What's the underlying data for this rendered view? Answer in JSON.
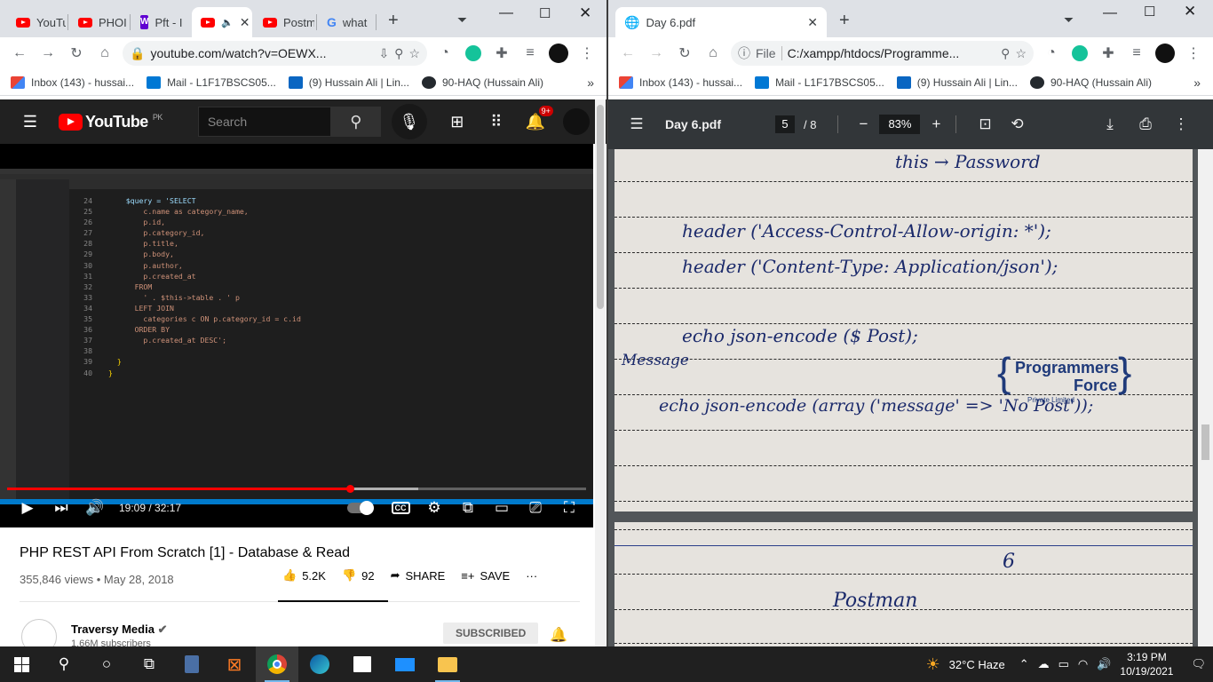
{
  "left": {
    "tabs": [
      {
        "label": "YouTu",
        "icon": "youtube-icon"
      },
      {
        "label": "PHOI",
        "icon": "youtube-icon"
      },
      {
        "label": "Pft - I",
        "icon": "w-icon"
      },
      {
        "label": "",
        "icon": "youtube-icon",
        "active": true
      },
      {
        "label": "Postm",
        "icon": "youtube-icon"
      },
      {
        "label": "what",
        "icon": "google-icon"
      }
    ],
    "url": "youtube.com/watch?v=OEWX...",
    "bookmarks": [
      {
        "label": "Inbox (143) - hussai...",
        "icon": "gmail-icon"
      },
      {
        "label": "Mail - L1F17BSCS05...",
        "icon": "outlook-icon"
      },
      {
        "label": "(9) Hussain Ali | Lin...",
        "icon": "linkedin-icon"
      },
      {
        "label": "90-HAQ (Hussain Ali)",
        "icon": "github-icon"
      }
    ],
    "youtube": {
      "logo": "YouTube",
      "country": "PK",
      "search_placeholder": "Search",
      "notif_count": "9+"
    },
    "player": {
      "time": "19:09 / 32:17",
      "progress": 0.592,
      "buffered": 0.71
    },
    "code_lines": [
      {
        "n": "24",
        "t": "    $query = 'SELECT"
      },
      {
        "n": "25",
        "t": "        c.name as category_name,"
      },
      {
        "n": "26",
        "t": "        p.id,"
      },
      {
        "n": "27",
        "t": "        p.category_id,"
      },
      {
        "n": "28",
        "t": "        p.title,"
      },
      {
        "n": "29",
        "t": "        p.body,"
      },
      {
        "n": "30",
        "t": "        p.author,"
      },
      {
        "n": "31",
        "t": "        p.created_at"
      },
      {
        "n": "32",
        "t": "      FROM"
      },
      {
        "n": "33",
        "t": "        ' . $this->table . ' p"
      },
      {
        "n": "34",
        "t": "      LEFT JOIN"
      },
      {
        "n": "35",
        "t": "        categories c ON p.category_id = c.id"
      },
      {
        "n": "36",
        "t": "      ORDER BY"
      },
      {
        "n": "37",
        "t": "        p.created_at DESC';"
      },
      {
        "n": "38",
        "t": ""
      },
      {
        "n": "39",
        "t": "  }"
      },
      {
        "n": "40",
        "t": "}"
      }
    ],
    "video": {
      "title": "PHP REST API From Scratch [1] - Database & Read",
      "meta": "355,846 views • May 28, 2018",
      "likes": "5.2K",
      "dislikes": "92",
      "share": "SHARE",
      "save": "SAVE"
    },
    "channel": {
      "name": "Traversy Media",
      "subs": "1.66M subscribers",
      "subscribed": "SUBSCRIBED"
    }
  },
  "right": {
    "tab": "Day 6.pdf",
    "url_prefix": "File",
    "url": "C:/xampp/htdocs/Programme...",
    "bookmarks": [
      {
        "label": "Inbox (143) - hussai...",
        "icon": "gmail-icon"
      },
      {
        "label": "Mail - L1F17BSCS05...",
        "icon": "outlook-icon"
      },
      {
        "label": "(9) Hussain Ali | Lin...",
        "icon": "linkedin-icon"
      },
      {
        "label": "90-HAQ (Hussain Ali)",
        "icon": "github-icon"
      }
    ],
    "pdf": {
      "name": "Day 6.pdf",
      "page": "5",
      "total": "/ 8",
      "zoom": "83%"
    },
    "page1": {
      "l1": "this → Password",
      "l2": "header ('Access-Control-Allow-origin: *');",
      "l3": "header ('Content-Type: Application/json');",
      "l4": "echo   json-encode ($ Post);",
      "l5": "Message",
      "l6": "echo  json-encode (array ('message' => 'No Post'));",
      "wm1": "Programmers",
      "wm2": "Force",
      "wm3": "Private Limited"
    },
    "page2": {
      "num": "6",
      "l1": "Postman"
    }
  },
  "taskbar": {
    "weather": "32°C  Haze",
    "time": "3:19 PM",
    "date": "10/19/2021"
  }
}
